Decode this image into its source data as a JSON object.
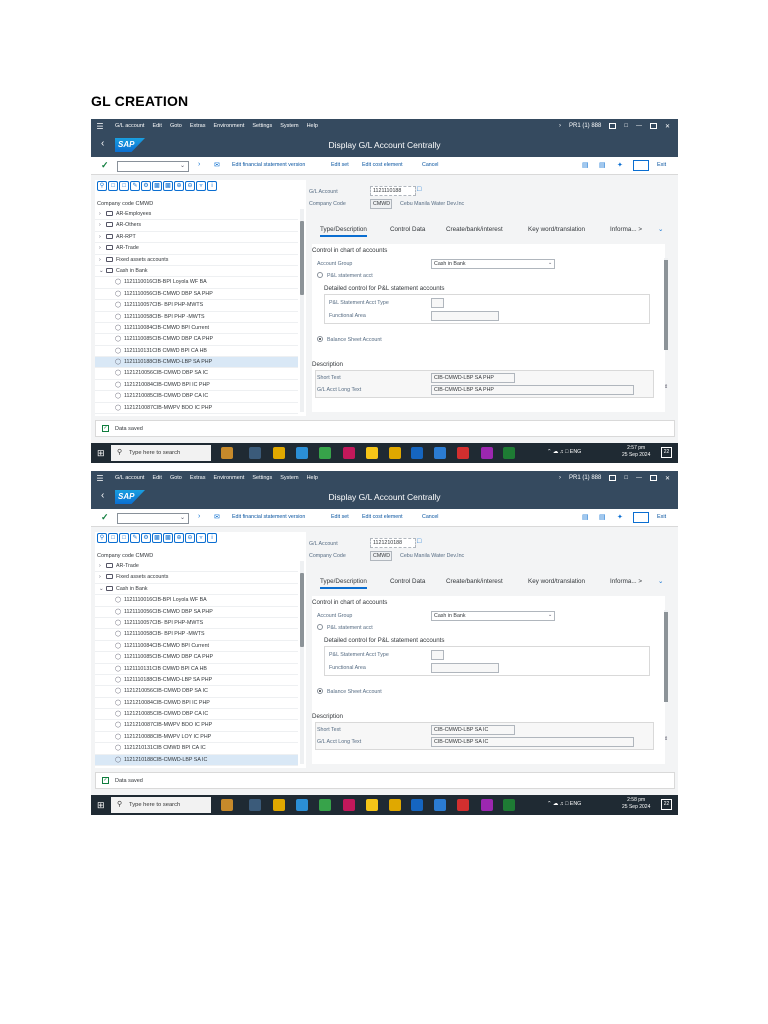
{
  "doc_title": "GL CREATION",
  "screens": [
    {
      "menu": [
        "G/L account",
        "Edit",
        "Goto",
        "Extras",
        "Environment",
        "Settings",
        "System",
        "Help"
      ],
      "system_id": "PR1 (1) 888",
      "window_title": "Display G/L Account Centrally",
      "toolbar_links": [
        "Edit financial statement version",
        "Edit set",
        "Edit cost element",
        "Cancel"
      ],
      "exit_label": "Exit",
      "company_code_label": "Company code CMWD",
      "tree": [
        {
          "type": "folder",
          "label": "AR-Employees"
        },
        {
          "type": "folder",
          "label": "AR-Others"
        },
        {
          "type": "folder",
          "label": "AR-RPT"
        },
        {
          "type": "folder",
          "label": "AR-Trade"
        },
        {
          "type": "folder",
          "label": "Fixed assets accounts"
        },
        {
          "type": "folder-open",
          "label": "Cash in Bank"
        },
        {
          "type": "leaf",
          "label": "1121110016CIB-BPI Loyola WF BA"
        },
        {
          "type": "leaf",
          "label": "1121110056CIB-CMWD DBP SA PHP"
        },
        {
          "type": "leaf",
          "label": "1121110057CIB- BPI PHP-MWTS"
        },
        {
          "type": "leaf",
          "label": "1121110058CIB- BPI PHP -MWTS"
        },
        {
          "type": "leaf",
          "label": "1121110084CIB-CMWD BPI Current"
        },
        {
          "type": "leaf",
          "label": "1121110085CIB-CMWD DBP CA PHP"
        },
        {
          "type": "leaf",
          "label": "1121110131CIB CMWD BPI CA HB"
        },
        {
          "type": "leaf",
          "label": "1121110188CIB-CMWD-LBP SA PHP",
          "selected": true
        },
        {
          "type": "leaf",
          "label": "1121210056CIB-CMWD DBP SA IC"
        },
        {
          "type": "leaf",
          "label": "1121210084CIB-CMWD BPI IC PHP"
        },
        {
          "type": "leaf",
          "label": "1121210085CIB-CMWD DBP CA IC"
        },
        {
          "type": "leaf",
          "label": "1121210087CIB-MWPV BDO  IC PHP"
        }
      ],
      "gl_account_label": "G/L Account",
      "gl_account": "1121110188",
      "company_code_field_label": "Company Code",
      "company_code": "CMWD",
      "company_name": "Cebu Manila Water Dev.Inc",
      "tabs": [
        "Type/Description",
        "Control Data",
        "Create/bank/interest",
        "Key word/translation",
        "Informa... >"
      ],
      "section_coa": "Control in chart of accounts",
      "account_group_label": "Account Group",
      "account_group": "Cash in Bank",
      "pl_radio_label": "P&L statement acct",
      "detailed_control": "Detailed control for P&L statement accounts",
      "pl_type_label": "P&L Statement Acct Type",
      "functional_area_label": "Functional Area",
      "bs_radio_label": "Balance Sheet Account",
      "section_desc": "Description",
      "short_text_label": "Short Text",
      "short_text": "CIB-CMWD-LBP SA PHP",
      "long_text_label": "G/L Acct Long Text",
      "long_text": "CIB-CMWD-LBP SA PHP",
      "status": "Data saved",
      "search_placeholder": "Type here to search",
      "tray": "ENG",
      "clock_time": "2:57 pm",
      "clock_date": "25 Sep 2024",
      "notif": "22"
    },
    {
      "menu": [
        "G/L account",
        "Edit",
        "Goto",
        "Extras",
        "Environment",
        "Settings",
        "System",
        "Help"
      ],
      "system_id": "PR1 (1) 888",
      "window_title": "Display G/L Account Centrally",
      "toolbar_links": [
        "Edit financial statement version",
        "Edit set",
        "Edit cost element",
        "Cancel"
      ],
      "exit_label": "Exit",
      "company_code_label": "Company code CMWD",
      "tree": [
        {
          "type": "folder",
          "label": "AR-Trade"
        },
        {
          "type": "folder",
          "label": "Fixed assets accounts"
        },
        {
          "type": "folder-open",
          "label": "Cash in Bank"
        },
        {
          "type": "leaf",
          "label": "1121110016CIB-BPI Loyola WF BA"
        },
        {
          "type": "leaf",
          "label": "1121110056CIB-CMWD DBP SA PHP"
        },
        {
          "type": "leaf",
          "label": "1121110057CIB- BPI PHP-MWTS"
        },
        {
          "type": "leaf",
          "label": "1121110058CIB- BPI PHP -MWTS"
        },
        {
          "type": "leaf",
          "label": "1121110084CIB-CMWD BPI Current"
        },
        {
          "type": "leaf",
          "label": "1121110085CIB-CMWD DBP CA PHP"
        },
        {
          "type": "leaf",
          "label": "1121110131CIB CMWD BPI CA HB"
        },
        {
          "type": "leaf",
          "label": "1121110188CIB-CMWD-LBP SA PHP"
        },
        {
          "type": "leaf",
          "label": "1121210056CIB-CMWD DBP SA IC"
        },
        {
          "type": "leaf",
          "label": "1121210084CIB-CMWD BPI IC PHP"
        },
        {
          "type": "leaf",
          "label": "1121210085CIB-CMWD DBP CA IC"
        },
        {
          "type": "leaf",
          "label": "1121210087CIB-MWPV BDO  IC PHP"
        },
        {
          "type": "leaf",
          "label": "1121210088CIB-MWPV LOY  IC PHP"
        },
        {
          "type": "leaf",
          "label": "1121210131CIB CMWD BPI CA IC"
        },
        {
          "type": "leaf",
          "label": "1121210188CIB-CMWD-LBP SA IC",
          "selected": true
        }
      ],
      "gl_account_label": "G/L Account",
      "gl_account": "1121210188",
      "company_code_field_label": "Company Code",
      "company_code": "CMWD",
      "company_name": "Cebu Manila Water Dev.Inc",
      "tabs": [
        "Type/Description",
        "Control Data",
        "Create/bank/interest",
        "Key word/translation",
        "Informa... >"
      ],
      "section_coa": "Control in chart of accounts",
      "account_group_label": "Account Group",
      "account_group": "Cash in Bank",
      "pl_radio_label": "P&L statement acct",
      "detailed_control": "Detailed control for P&L statement accounts",
      "pl_type_label": "P&L Statement Acct Type",
      "functional_area_label": "Functional Area",
      "bs_radio_label": "Balance Sheet Account",
      "section_desc": "Description",
      "short_text_label": "Short Text",
      "short_text": "CIB-CMWD-LBP SA IC",
      "long_text_label": "G/L Acct Long Text",
      "long_text": "CIB-CMWD-LBP SA IC",
      "status": "Data saved",
      "search_placeholder": "Type here to search",
      "tray": "ENG",
      "clock_time": "2:58 pm",
      "clock_date": "25 Sep 2024",
      "notif": "22"
    }
  ],
  "colors": {
    "shell_header": "#354a5f",
    "link_blue": "#0854a0",
    "selected_row": "#d9e8f6",
    "taskbar": "#1f2a33",
    "success_green": "#107e3e"
  }
}
